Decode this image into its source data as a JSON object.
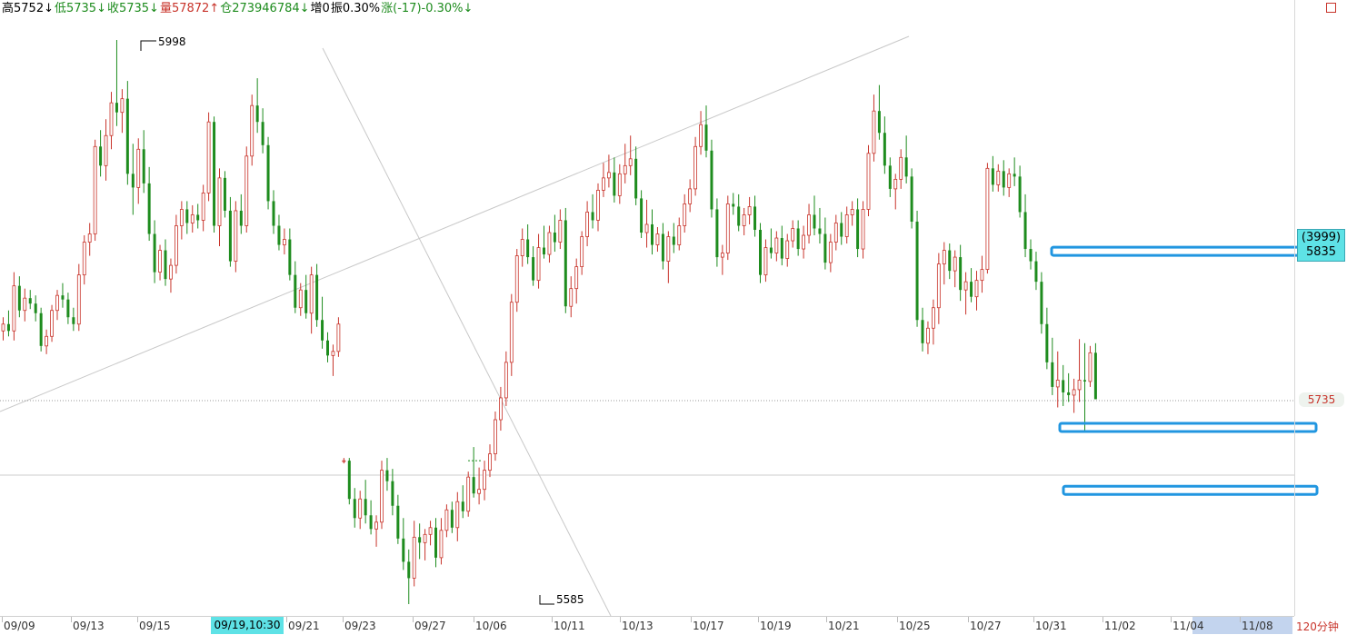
{
  "info_bar": {
    "high": "高5752↓",
    "low": "低5735↓",
    "close": "收5735↓",
    "volume": "量57872↑",
    "open_interest": "仓273946784↓",
    "increase": "增0",
    "amplitude": "振0.30%",
    "change": "涨(-17)-0.30%↓"
  },
  "colors": {
    "up": "#c8342b",
    "down": "#1e8c1e",
    "accent": "#5ee2e6",
    "box": "#2196e0"
  },
  "annotations": {
    "high_label": "5998",
    "low_label": "5585"
  },
  "right_axis": {
    "cursor_count": "(3999)",
    "cursor_price": "5835",
    "last_price": "5735",
    "period": "120分钟"
  },
  "x_axis": {
    "cursor_date": "09/19,10:30",
    "ticks": [
      "09/09",
      "09/13",
      "09/15",
      "09/21",
      "09/23",
      "09/27",
      "10/06",
      "10/11",
      "10/13",
      "10/17",
      "10/19",
      "10/21",
      "10/25",
      "10/27",
      "10/31",
      "11/02",
      "11/04",
      "11/08"
    ]
  },
  "chart_data": {
    "type": "candlestick",
    "instrument_high": 5998,
    "instrument_low": 5585,
    "y_range": [
      5560,
      6020
    ],
    "last_close": 5735,
    "reference_level": 5690,
    "support_zones": [
      5843,
      5714,
      5668
    ],
    "ohlc": [
      [
        5785,
        5795,
        5778,
        5790
      ],
      [
        5790,
        5800,
        5781,
        5785
      ],
      [
        5785,
        5828,
        5778,
        5818
      ],
      [
        5818,
        5825,
        5795,
        5800
      ],
      [
        5800,
        5816,
        5792,
        5809
      ],
      [
        5809,
        5815,
        5801,
        5805
      ],
      [
        5805,
        5811,
        5792,
        5798
      ],
      [
        5798,
        5802,
        5770,
        5774
      ],
      [
        5774,
        5786,
        5768,
        5781
      ],
      [
        5781,
        5804,
        5777,
        5800
      ],
      [
        5800,
        5815,
        5793,
        5811
      ],
      [
        5811,
        5820,
        5802,
        5808
      ],
      [
        5808,
        5813,
        5790,
        5795
      ],
      [
        5795,
        5802,
        5785,
        5790
      ],
      [
        5790,
        5834,
        5785,
        5826
      ],
      [
        5826,
        5855,
        5819,
        5850
      ],
      [
        5850,
        5864,
        5840,
        5856
      ],
      [
        5856,
        5925,
        5851,
        5920
      ],
      [
        5920,
        5932,
        5898,
        5906
      ],
      [
        5906,
        5940,
        5895,
        5928
      ],
      [
        5928,
        5960,
        5918,
        5952
      ],
      [
        5952,
        5998,
        5935,
        5945
      ],
      [
        5945,
        5962,
        5930,
        5955
      ],
      [
        5955,
        5968,
        5892,
        5900
      ],
      [
        5900,
        5922,
        5870,
        5890
      ],
      [
        5890,
        5926,
        5878,
        5918
      ],
      [
        5918,
        5932,
        5886,
        5893
      ],
      [
        5893,
        5905,
        5851,
        5856
      ],
      [
        5856,
        5866,
        5820,
        5828
      ],
      [
        5828,
        5848,
        5822,
        5844
      ],
      [
        5844,
        5852,
        5818,
        5823
      ],
      [
        5823,
        5838,
        5813,
        5833
      ],
      [
        5833,
        5870,
        5827,
        5862
      ],
      [
        5862,
        5880,
        5852,
        5874
      ],
      [
        5874,
        5880,
        5856,
        5864
      ],
      [
        5864,
        5877,
        5857,
        5870
      ],
      [
        5870,
        5878,
        5860,
        5866
      ],
      [
        5866,
        5892,
        5858,
        5886
      ],
      [
        5886,
        5945,
        5880,
        5938
      ],
      [
        5938,
        5942,
        5857,
        5862
      ],
      [
        5862,
        5904,
        5847,
        5897
      ],
      [
        5897,
        5902,
        5868,
        5873
      ],
      [
        5873,
        5883,
        5832,
        5836
      ],
      [
        5836,
        5880,
        5828,
        5873
      ],
      [
        5873,
        5885,
        5856,
        5862
      ],
      [
        5862,
        5920,
        5857,
        5913
      ],
      [
        5913,
        5958,
        5906,
        5950
      ],
      [
        5950,
        5970,
        5930,
        5938
      ],
      [
        5938,
        5948,
        5915,
        5921
      ],
      [
        5921,
        5927,
        5874,
        5880
      ],
      [
        5880,
        5888,
        5856,
        5862
      ],
      [
        5862,
        5870,
        5844,
        5848
      ],
      [
        5848,
        5860,
        5841,
        5852
      ],
      [
        5852,
        5860,
        5822,
        5826
      ],
      [
        5826,
        5836,
        5798,
        5802
      ],
      [
        5802,
        5820,
        5796,
        5815
      ],
      [
        5815,
        5826,
        5794,
        5798
      ],
      [
        5798,
        5832,
        5783,
        5826
      ],
      [
        5826,
        5834,
        5788,
        5793
      ],
      [
        5793,
        5810,
        5772,
        5778
      ],
      [
        5778,
        5784,
        5762,
        5767
      ],
      [
        5767,
        5775,
        5752,
        5770
      ],
      [
        5770,
        5795,
        5766,
        5790
      ],
      [
        5690,
        5692,
        5688,
        5690
      ],
      [
        5690,
        5692,
        5658,
        5662
      ],
      [
        5662,
        5670,
        5641,
        5648
      ],
      [
        5648,
        5668,
        5640,
        5662
      ],
      [
        5662,
        5676,
        5644,
        5650
      ],
      [
        5650,
        5661,
        5636,
        5640
      ],
      [
        5640,
        5650,
        5627,
        5645
      ],
      [
        5645,
        5690,
        5640,
        5683
      ],
      [
        5683,
        5692,
        5668,
        5675
      ],
      [
        5675,
        5684,
        5650,
        5657
      ],
      [
        5657,
        5665,
        5629,
        5633
      ],
      [
        5633,
        5648,
        5610,
        5616
      ],
      [
        5616,
        5625,
        5585,
        5604
      ],
      [
        5604,
        5646,
        5598,
        5634
      ],
      [
        5634,
        5644,
        5618,
        5630
      ],
      [
        5630,
        5640,
        5617,
        5636
      ],
      [
        5636,
        5646,
        5628,
        5641
      ],
      [
        5641,
        5648,
        5612,
        5619
      ],
      [
        5619,
        5648,
        5614,
        5639
      ],
      [
        5639,
        5658,
        5634,
        5654
      ],
      [
        5654,
        5660,
        5637,
        5641
      ],
      [
        5641,
        5667,
        5631,
        5660
      ],
      [
        5660,
        5672,
        5648,
        5653
      ],
      [
        5653,
        5682,
        5649,
        5678
      ],
      [
        5678,
        5700,
        5663,
        5666
      ],
      [
        5666,
        5685,
        5658,
        5669
      ],
      [
        5669,
        5690,
        5661,
        5683
      ],
      [
        5683,
        5702,
        5678,
        5695
      ],
      [
        5695,
        5726,
        5690,
        5720
      ],
      [
        5720,
        5744,
        5712,
        5736
      ],
      [
        5736,
        5770,
        5730,
        5762
      ],
      [
        5762,
        5812,
        5752,
        5806
      ],
      [
        5806,
        5845,
        5799,
        5840
      ],
      [
        5840,
        5860,
        5832,
        5852
      ],
      [
        5852,
        5863,
        5834,
        5839
      ],
      [
        5839,
        5847,
        5818,
        5822
      ],
      [
        5822,
        5856,
        5816,
        5846
      ],
      [
        5846,
        5862,
        5838,
        5841
      ],
      [
        5841,
        5862,
        5835,
        5857
      ],
      [
        5857,
        5870,
        5843,
        5850
      ],
      [
        5850,
        5874,
        5845,
        5866
      ],
      [
        5866,
        5875,
        5798,
        5803
      ],
      [
        5803,
        5825,
        5795,
        5816
      ],
      [
        5816,
        5838,
        5805,
        5832
      ],
      [
        5832,
        5858,
        5826,
        5854
      ],
      [
        5854,
        5880,
        5847,
        5872
      ],
      [
        5872,
        5885,
        5860,
        5866
      ],
      [
        5866,
        5893,
        5858,
        5888
      ],
      [
        5888,
        5908,
        5883,
        5897
      ],
      [
        5897,
        5914,
        5890,
        5901
      ],
      [
        5901,
        5912,
        5879,
        5884
      ],
      [
        5884,
        5907,
        5878,
        5900
      ],
      [
        5900,
        5922,
        5893,
        5906
      ],
      [
        5906,
        5928,
        5899,
        5911
      ],
      [
        5911,
        5920,
        5877,
        5882
      ],
      [
        5882,
        5888,
        5853,
        5857
      ],
      [
        5857,
        5881,
        5846,
        5863
      ],
      [
        5863,
        5874,
        5841,
        5848
      ],
      [
        5848,
        5861,
        5843,
        5856
      ],
      [
        5856,
        5864,
        5830,
        5836
      ],
      [
        5836,
        5858,
        5820,
        5854
      ],
      [
        5854,
        5864,
        5842,
        5848
      ],
      [
        5848,
        5868,
        5844,
        5862
      ],
      [
        5862,
        5885,
        5857,
        5878
      ],
      [
        5878,
        5896,
        5872,
        5889
      ],
      [
        5889,
        5927,
        5884,
        5920
      ],
      [
        5920,
        5946,
        5914,
        5936
      ],
      [
        5936,
        5950,
        5912,
        5917
      ],
      [
        5917,
        5925,
        5868,
        5874
      ],
      [
        5874,
        5882,
        5832,
        5839
      ],
      [
        5839,
        5848,
        5826,
        5842
      ],
      [
        5842,
        5884,
        5837,
        5878
      ],
      [
        5878,
        5886,
        5870,
        5876
      ],
      [
        5876,
        5885,
        5858,
        5862
      ],
      [
        5862,
        5875,
        5855,
        5870
      ],
      [
        5870,
        5883,
        5863,
        5876
      ],
      [
        5876,
        5884,
        5854,
        5859
      ],
      [
        5859,
        5864,
        5820,
        5826
      ],
      [
        5826,
        5852,
        5821,
        5846
      ],
      [
        5846,
        5860,
        5838,
        5842
      ],
      [
        5842,
        5858,
        5836,
        5853
      ],
      [
        5853,
        5862,
        5833,
        5838
      ],
      [
        5838,
        5856,
        5832,
        5851
      ],
      [
        5851,
        5866,
        5846,
        5860
      ],
      [
        5860,
        5866,
        5840,
        5845
      ],
      [
        5845,
        5862,
        5838,
        5855
      ],
      [
        5855,
        5878,
        5849,
        5870
      ],
      [
        5870,
        5884,
        5855,
        5860
      ],
      [
        5860,
        5875,
        5849,
        5856
      ],
      [
        5856,
        5868,
        5830,
        5835
      ],
      [
        5835,
        5856,
        5828,
        5850
      ],
      [
        5850,
        5870,
        5844,
        5864
      ],
      [
        5864,
        5872,
        5848,
        5854
      ],
      [
        5854,
        5876,
        5849,
        5870
      ],
      [
        5870,
        5880,
        5862,
        5874
      ],
      [
        5874,
        5882,
        5839,
        5845
      ],
      [
        5845,
        5880,
        5838,
        5874
      ],
      [
        5874,
        5921,
        5869,
        5915
      ],
      [
        5915,
        5958,
        5909,
        5946
      ],
      [
        5946,
        5965,
        5925,
        5930
      ],
      [
        5930,
        5942,
        5900,
        5906
      ],
      [
        5906,
        5912,
        5883,
        5889
      ],
      [
        5889,
        5900,
        5874,
        5896
      ],
      [
        5896,
        5918,
        5889,
        5912
      ],
      [
        5912,
        5928,
        5893,
        5898
      ],
      [
        5898,
        5904,
        5860,
        5865
      ],
      [
        5865,
        5873,
        5788,
        5793
      ],
      [
        5793,
        5802,
        5770,
        5776
      ],
      [
        5776,
        5792,
        5768,
        5787
      ],
      [
        5787,
        5808,
        5775,
        5802
      ],
      [
        5802,
        5842,
        5790,
        5834
      ],
      [
        5834,
        5850,
        5819,
        5844
      ],
      [
        5844,
        5849,
        5823,
        5829
      ],
      [
        5829,
        5844,
        5817,
        5839
      ],
      [
        5839,
        5848,
        5807,
        5815
      ],
      [
        5815,
        5828,
        5797,
        5821
      ],
      [
        5821,
        5831,
        5806,
        5810
      ],
      [
        5810,
        5829,
        5800,
        5822
      ],
      [
        5822,
        5840,
        5813,
        5830
      ],
      [
        5830,
        5908,
        5827,
        5904
      ],
      [
        5904,
        5913,
        5887,
        5892
      ],
      [
        5892,
        5907,
        5887,
        5902
      ],
      [
        5902,
        5910,
        5884,
        5890
      ],
      [
        5890,
        5904,
        5883,
        5900
      ],
      [
        5900,
        5912,
        5891,
        5898
      ],
      [
        5898,
        5906,
        5868,
        5872
      ],
      [
        5872,
        5885,
        5839,
        5845
      ],
      [
        5845,
        5852,
        5830,
        5836
      ],
      [
        5836,
        5843,
        5815,
        5821
      ],
      [
        5821,
        5828,
        5783,
        5790
      ],
      [
        5790,
        5802,
        5757,
        5762
      ],
      [
        5762,
        5780,
        5738,
        5744
      ],
      [
        5744,
        5770,
        5729,
        5749
      ],
      [
        5749,
        5760,
        5730,
        5740
      ],
      [
        5740,
        5754,
        5733,
        5738
      ],
      [
        5738,
        5750,
        5725,
        5742
      ],
      [
        5742,
        5779,
        5733,
        5749
      ],
      [
        5749,
        5776,
        5712,
        5748
      ],
      [
        5748,
        5774,
        5744,
        5769
      ],
      [
        5769,
        5776,
        5735,
        5735
      ]
    ],
    "visible_dates": [
      "09/09",
      "09/13",
      "09/15",
      "09/19",
      "09/21",
      "09/23",
      "09/27",
      "10/06",
      "10/11",
      "10/13",
      "10/17",
      "10/19",
      "10/21",
      "10/25",
      "10/27",
      "10/31",
      "11/02",
      "11/04",
      "11/08"
    ]
  }
}
